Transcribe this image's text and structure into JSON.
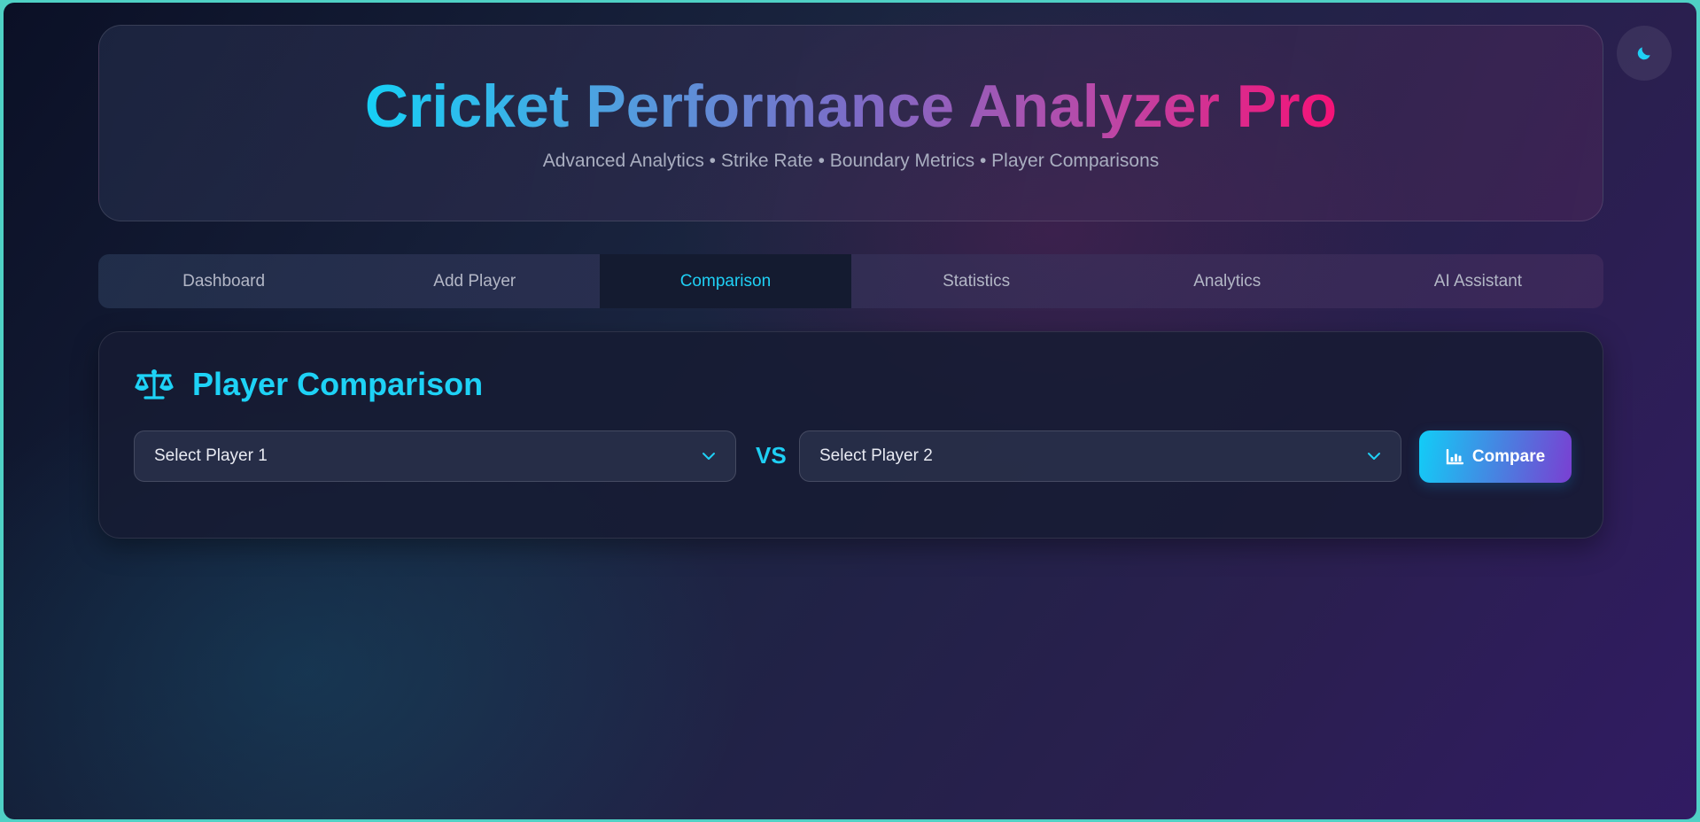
{
  "header": {
    "title": "Cricket Performance Analyzer Pro",
    "subtitle": "Advanced Analytics • Strike Rate • Boundary Metrics • Player Comparisons"
  },
  "theme_toggle": {
    "icon": "moon-icon"
  },
  "tabs": [
    {
      "label": "Dashboard",
      "active": false
    },
    {
      "label": "Add Player",
      "active": false
    },
    {
      "label": "Comparison",
      "active": true
    },
    {
      "label": "Statistics",
      "active": false
    },
    {
      "label": "Analytics",
      "active": false
    },
    {
      "label": "AI Assistant",
      "active": false
    }
  ],
  "comparison": {
    "icon": "scale-icon",
    "title": "Player Comparison",
    "player1": {
      "value": "Select Player 1"
    },
    "vs_label": "VS",
    "player2": {
      "value": "Select Player 2"
    },
    "compare_button": {
      "icon": "chart-icon",
      "label": "Compare"
    }
  },
  "colors": {
    "accent": "#1fd0f5",
    "title_gradient_start": "#16d0f5",
    "title_gradient_end": "#f51277",
    "button_gradient_end": "#7a3fd2"
  }
}
